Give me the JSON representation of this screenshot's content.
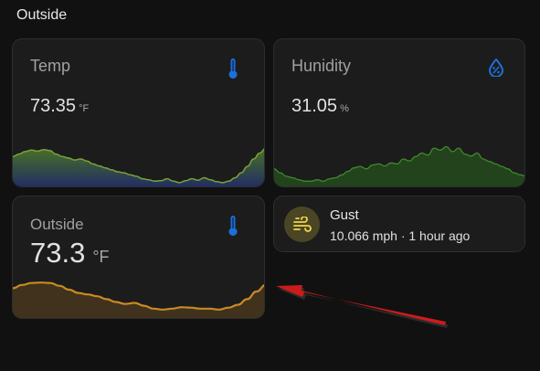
{
  "section": {
    "title": "Outside"
  },
  "cards": {
    "temp": {
      "name": "Temp",
      "value": "73.35",
      "unit": "°F",
      "icon": "thermometer-icon",
      "history": [
        0.55,
        0.6,
        0.65,
        0.68,
        0.66,
        0.69,
        0.67,
        0.6,
        0.55,
        0.52,
        0.48,
        0.5,
        0.46,
        0.4,
        0.36,
        0.32,
        0.28,
        0.24,
        0.22,
        0.18,
        0.15,
        0.1,
        0.08,
        0.05,
        0.06,
        0.1,
        0.05,
        0.02,
        0.06,
        0.1,
        0.07,
        0.12,
        0.08,
        0.04,
        0.02,
        0.05,
        0.12,
        0.22,
        0.35,
        0.5,
        0.62,
        0.72
      ]
    },
    "humidity": {
      "name": "Hunidity",
      "value": "31.05",
      "unit": "%",
      "icon": "water-percent-icon",
      "history": [
        0.3,
        0.22,
        0.15,
        0.12,
        0.08,
        0.05,
        0.05,
        0.08,
        0.05,
        0.1,
        0.12,
        0.18,
        0.25,
        0.32,
        0.35,
        0.3,
        0.38,
        0.4,
        0.36,
        0.42,
        0.4,
        0.5,
        0.46,
        0.55,
        0.62,
        0.58,
        0.72,
        0.68,
        0.75,
        0.65,
        0.72,
        0.6,
        0.56,
        0.62,
        0.5,
        0.45,
        0.4,
        0.35,
        0.3,
        0.22,
        0.18,
        0.15
      ]
    },
    "outside": {
      "name": "Outside",
      "value": "73.3",
      "unit": "°F",
      "icon": "thermometer-icon",
      "history": [
        0.55,
        0.62,
        0.66,
        0.67,
        0.66,
        0.6,
        0.52,
        0.45,
        0.42,
        0.38,
        0.32,
        0.26,
        0.22,
        0.24,
        0.18,
        0.12,
        0.1,
        0.12,
        0.15,
        0.14,
        0.12,
        0.12,
        0.1,
        0.14,
        0.2,
        0.32,
        0.48,
        0.62
      ]
    },
    "gust": {
      "name": "Gust",
      "state": "10.066 mph · 1 hour ago",
      "icon": "weather-windy-icon"
    }
  },
  "colors": {
    "temp_line": "#7aa33a",
    "temp_fill_top": "#4e7a26",
    "temp_fill_bottom": "#23306a",
    "humidity_line": "#3f8a2a",
    "humidity_fill": "#244a1d",
    "outside_line": "#c98924",
    "outside_fill": "#45351e",
    "icon_blue": "#1e6fd9",
    "gust_icon": "#f1d64a"
  }
}
